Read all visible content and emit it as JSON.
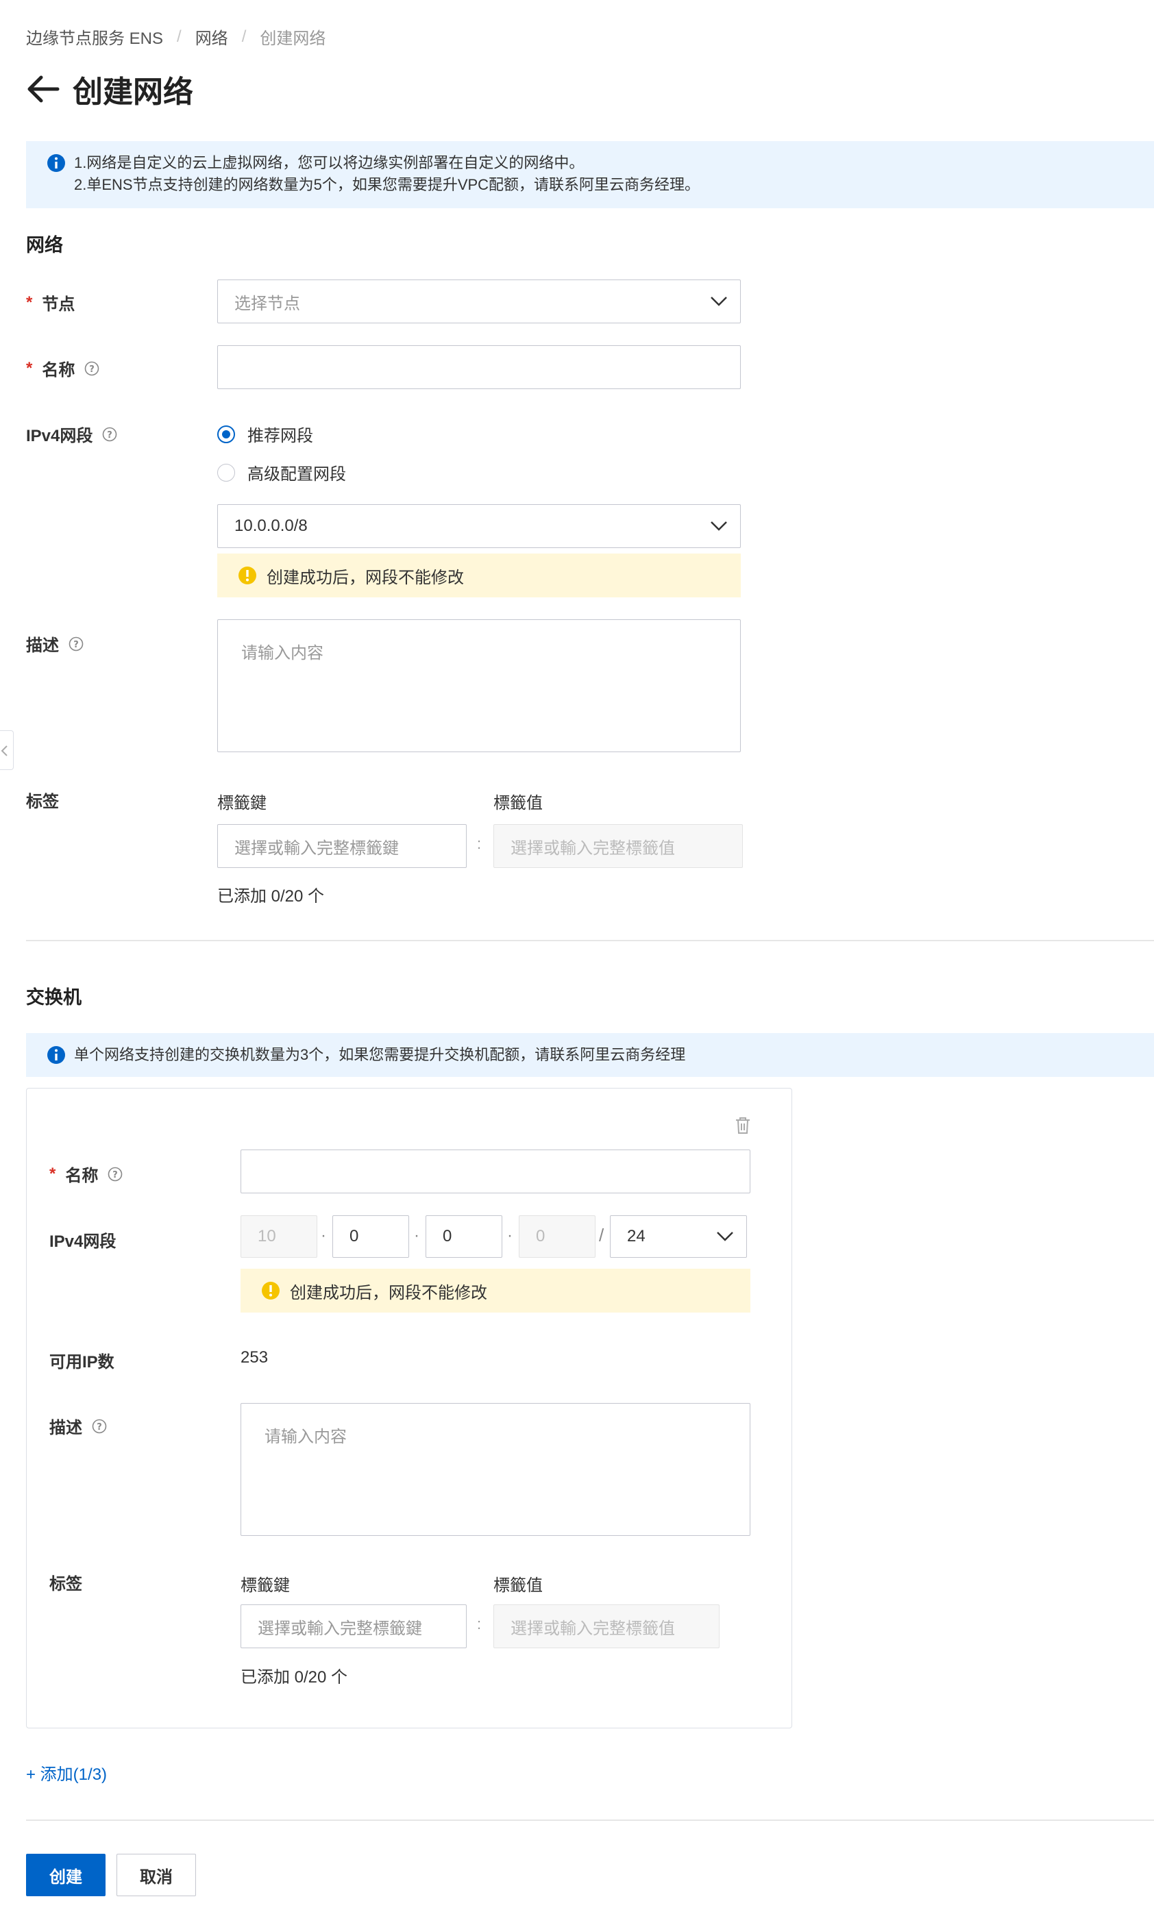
{
  "breadcrumb": {
    "item1": "边缘节点服务 ENS",
    "sep": "/",
    "item2": "网络",
    "item3": "创建网络"
  },
  "page_title": "创建网络",
  "notice_top": {
    "line1": "1.网络是自定义的云上虚拟网络，您可以将边缘实例部署在自定义的网络中。",
    "line2": "2.单ENS节点支持创建的网络数量为5个，如果您需要提升VPC配额，请联系阿里云商务经理。"
  },
  "network_section": {
    "title": "网络",
    "node_label": "节点",
    "node_placeholder": "选择节点",
    "name_label": "名称",
    "name_value": "",
    "ipv4_label": "IPv4网段",
    "radio_recommended": "推荐网段",
    "radio_advanced": "高级配置网段",
    "cidr_value": "10.0.0.0/8",
    "warn_text": "创建成功后，网段不能修改",
    "desc_label": "描述",
    "desc_placeholder": "请输入内容",
    "tags_label": "标签",
    "tag_key_header": "標籤鍵",
    "tag_value_header": "標籤值",
    "tag_key_placeholder": "選擇或輸入完整標籤鍵",
    "tag_value_placeholder": "選擇或輸入完整標籤值",
    "colon": ":",
    "tag_count": "已添加 0/20 个"
  },
  "switch_section": {
    "title": "交换机",
    "notice": "单个网络支持创建的交换机数量为3个，如果您需要提升交换机配额，请联系阿里云商务经理",
    "name_label": "名称",
    "name_value": "",
    "ipv4_label": "IPv4网段",
    "ip_octets": [
      "10",
      "0",
      "0",
      "0"
    ],
    "ip_dot": "·",
    "slash": "/",
    "mask": "24",
    "warn_text": "创建成功后，网段不能修改",
    "available_ip_label": "可用IP数",
    "available_ip_value": "253",
    "desc_label": "描述",
    "desc_placeholder": "请输入内容",
    "tags_label": "标签",
    "tag_key_header": "標籤鍵",
    "tag_value_header": "標籤值",
    "tag_key_placeholder": "選擇或輸入完整標籤鍵",
    "tag_value_placeholder": "選擇或輸入完整標籤值",
    "colon": ":",
    "tag_count": "已添加 0/20 个",
    "add_link": "+ 添加(1/3)"
  },
  "required_mark": "*",
  "buttons": {
    "create": "创建",
    "cancel": "取消"
  },
  "colors": {
    "primary": "#0064c8",
    "required": "#d93026",
    "notice_bg": "#eaf4fe",
    "warn_bg": "#fff7d9",
    "warn_icon": "#f5c400"
  }
}
